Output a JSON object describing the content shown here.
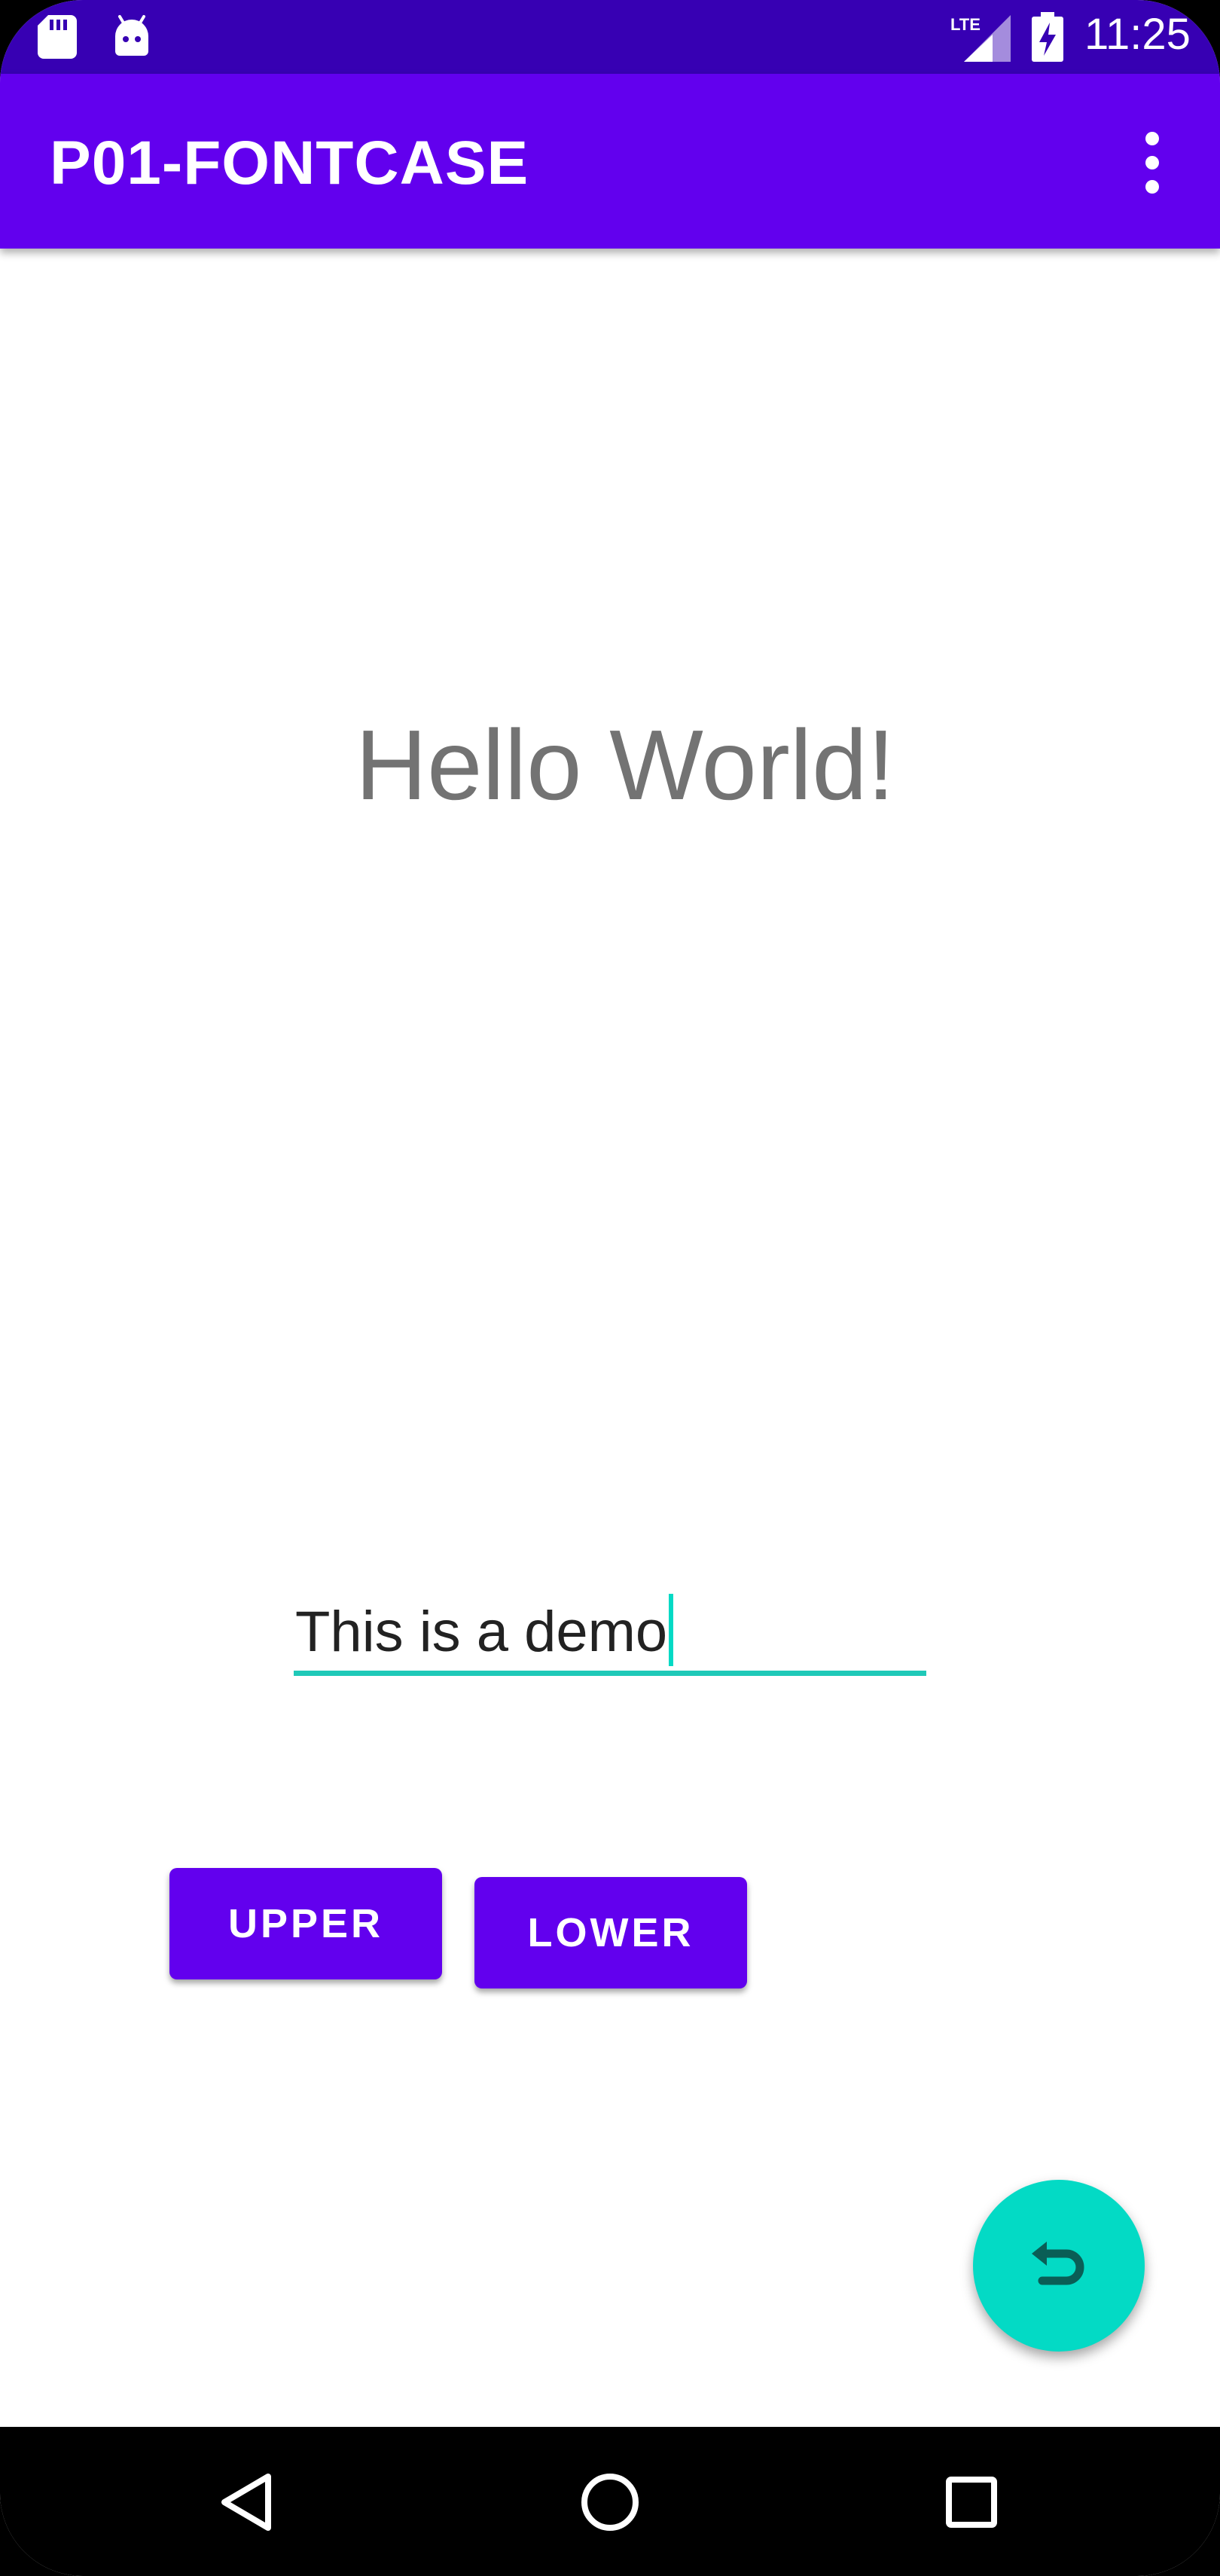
{
  "status_bar": {
    "time": "11:25",
    "network": "LTE",
    "icons": [
      "sd-card-icon",
      "android-icon",
      "lte-signal-icon",
      "battery-charging-icon"
    ]
  },
  "app_bar": {
    "title": "P01-FONTCASE",
    "menu_icon": "overflow-menu-icon"
  },
  "main": {
    "hello_text": "Hello World!",
    "input": {
      "value": "This is a demo"
    },
    "buttons": {
      "upper_label": "UPPER",
      "lower_label": "LOWER"
    },
    "fab_icon": "undo-icon"
  },
  "nav_bar": {
    "icons": [
      "back-icon",
      "home-icon",
      "recents-icon"
    ]
  },
  "colors": {
    "status_bar": "#3700b3",
    "primary": "#6200ee",
    "accent": "#03dac5",
    "text_gray": "#737373"
  }
}
